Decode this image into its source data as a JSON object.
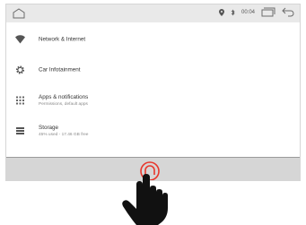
{
  "status_bar": {
    "time": "00:04",
    "icons": [
      "home-outline-icon",
      "location-icon",
      "bluetooth-icon",
      "recents-icon",
      "back-icon"
    ]
  },
  "settings": {
    "items": [
      {
        "icon": "wifi-icon",
        "title": "Network & Internet",
        "subtitle": ""
      },
      {
        "icon": "gear-icon",
        "title": "Car Infotainment",
        "subtitle": ""
      },
      {
        "icon": "apps-grid-icon",
        "title": "Apps & notifications",
        "subtitle": "Permissions, default apps"
      },
      {
        "icon": "storage-icon",
        "title": "Storage",
        "subtitle": "45% used - 17.46 GB free"
      }
    ]
  },
  "nav_bar": {
    "home_button_icon": "home-button-icon",
    "accent_color": "#e8372c"
  },
  "gesture": {
    "icon": "pointing-hand-icon"
  }
}
